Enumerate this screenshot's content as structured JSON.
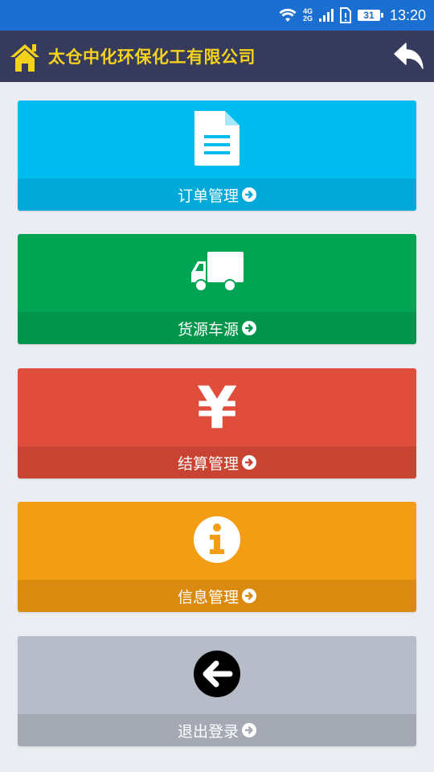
{
  "status_bar": {
    "time": "13:20",
    "battery": "31",
    "network_top": "4G",
    "network_bottom": "2G"
  },
  "header": {
    "title": "太仓中化环保化工有限公司",
    "title_color": "#f5d21a",
    "background": "#363b5e"
  },
  "menu": [
    {
      "label": "订单管理",
      "icon": "document-icon",
      "color": "#00bcee",
      "bar_color": "#00a9d8"
    },
    {
      "label": "货源车源",
      "icon": "truck-icon",
      "color": "#00a553",
      "bar_color": "#00954a"
    },
    {
      "label": "结算管理",
      "icon": "yen-icon",
      "glyph": "¥",
      "color": "#e04e3b",
      "bar_color": "#c94333"
    },
    {
      "label": "信息管理",
      "icon": "info-icon",
      "color": "#f39d14",
      "bar_color": "#da8b0f"
    },
    {
      "label": "退出登录",
      "icon": "arrow-left-circle-icon",
      "color": "#b7bcc9",
      "bar_color": "#a5a9b4"
    }
  ]
}
